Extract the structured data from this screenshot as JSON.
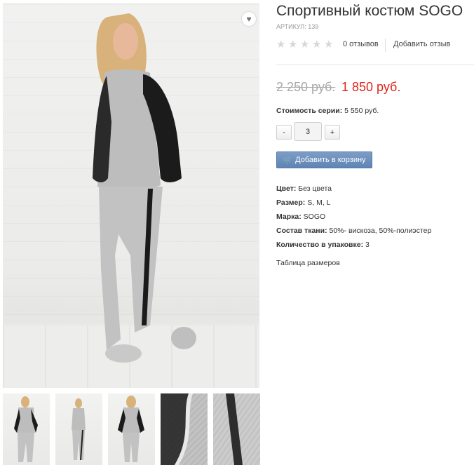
{
  "product": {
    "title": "Спортивный костюм SOGO",
    "sku": "АРТИКУЛ: 139",
    "reviews_count": "0 отзывов",
    "add_review": "Добавить отзыв",
    "rating": {
      "value": 0,
      "max": 5
    }
  },
  "price": {
    "old": "2 250 руб.",
    "new": "1 850 руб.",
    "series_label": "Стоимость серии:",
    "series_value": "5 550 руб.",
    "old_color": "#a8a8a8",
    "new_color": "#e0231b"
  },
  "quantity": {
    "minus": "-",
    "value": "3",
    "plus": "+"
  },
  "cart": {
    "label": "Добавить в корзину",
    "icon": "cart-icon",
    "color": "#6c8fbd"
  },
  "properties": [
    {
      "label": "Цвет:",
      "value": "Без цвета"
    },
    {
      "label": "Размер:",
      "value": "S, M, L"
    },
    {
      "label": "Марка:",
      "value": "SOGO"
    },
    {
      "label": "Состав ткани:",
      "value": "50%- вискоза, 50%-полиэстер"
    },
    {
      "label": "Количество в упаковке:",
      "value": "3"
    }
  ],
  "size_table_link": "Таблица размеров",
  "wishlist_icon": "heart-icon",
  "images": {
    "main": "product-photo-front",
    "thumbnails": [
      "thumb-front",
      "thumb-full",
      "thumb-back",
      "thumb-detail-lace-top",
      "thumb-detail-lace-side"
    ]
  }
}
